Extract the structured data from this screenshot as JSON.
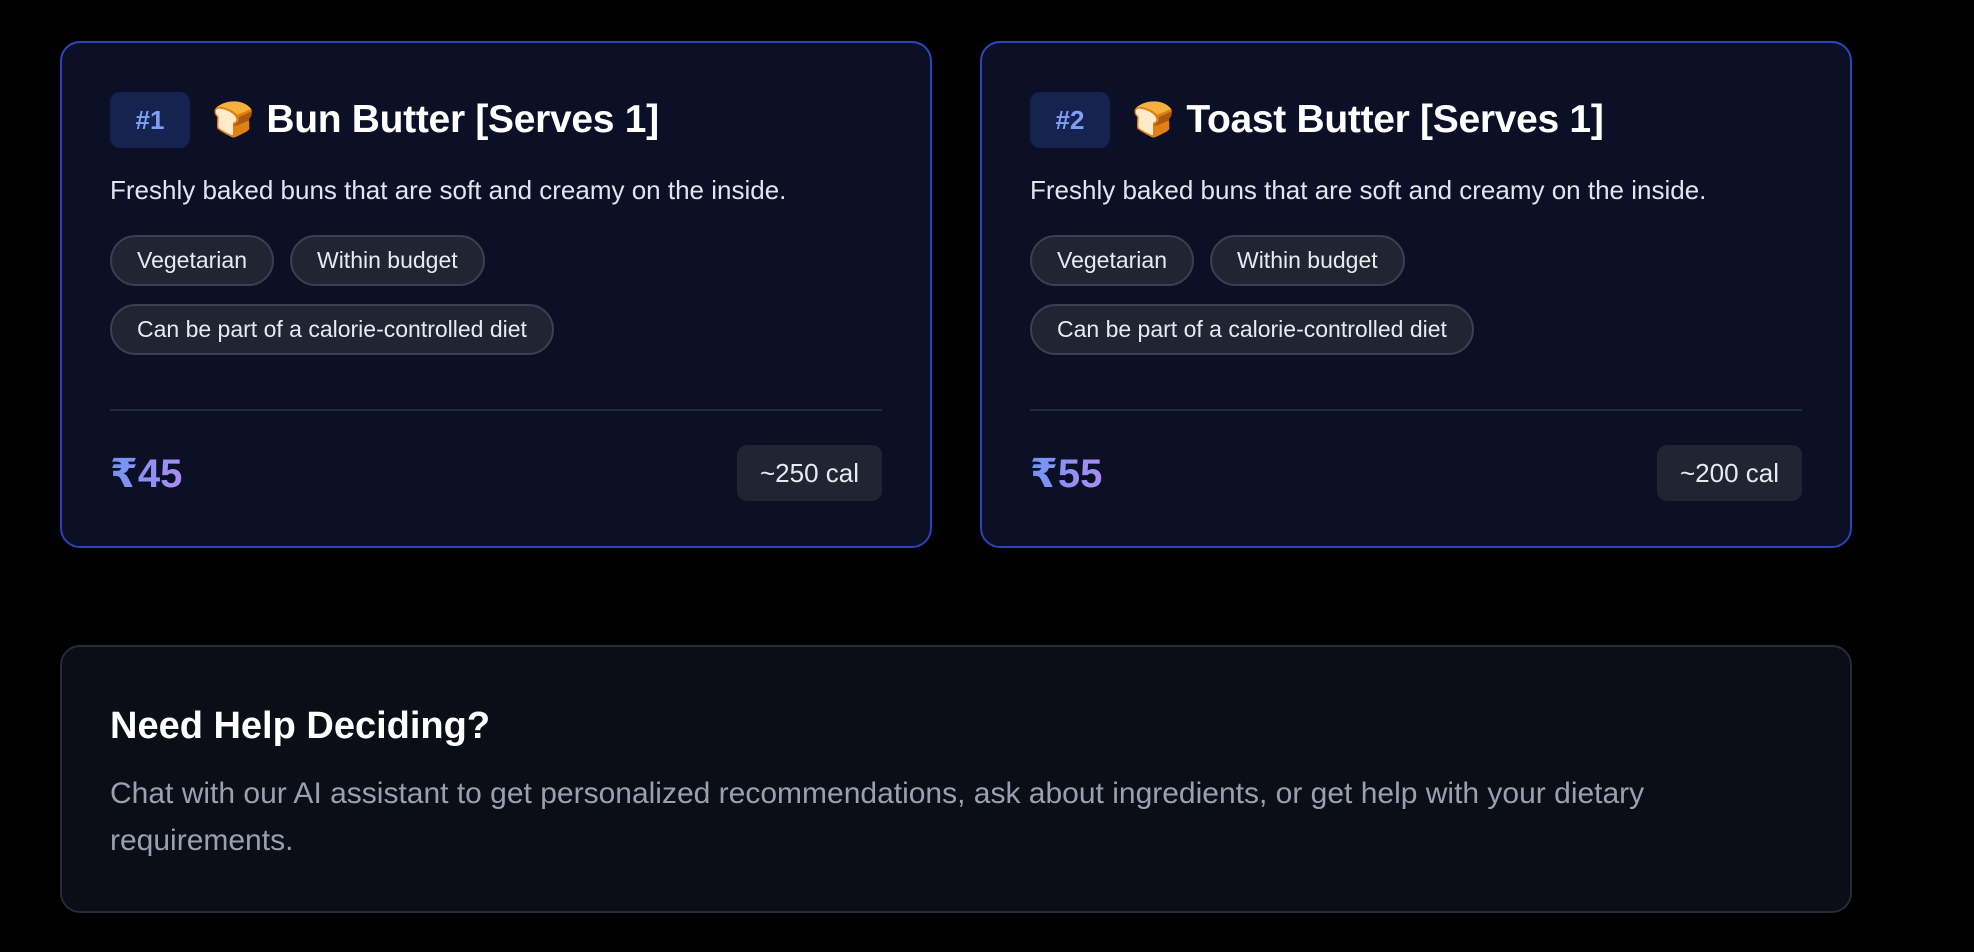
{
  "items": [
    {
      "rank": "#1",
      "emoji": "🍞",
      "name": "Bun Butter [Serves 1]",
      "description": "Freshly baked buns that are soft and creamy on the inside.",
      "tags": [
        "Vegetarian",
        "Within budget",
        "Can be part of a calorie-controlled diet"
      ],
      "price": "₹45",
      "calories": "~250 cal"
    },
    {
      "rank": "#2",
      "emoji": "🍞",
      "name": "Toast Butter [Serves 1]",
      "description": "Freshly baked buns that are soft and creamy on the inside.",
      "tags": [
        "Vegetarian",
        "Within budget",
        "Can be part of a calorie-controlled diet"
      ],
      "price": "₹55",
      "calories": "~200 cal"
    }
  ],
  "help": {
    "title": "Need Help Deciding?",
    "body": "Chat with our AI assistant to get personalized recommendations, ask about ingredients, or get help with your dietary requirements."
  },
  "colors": {
    "background": "#000000",
    "card_background": "#0b1027",
    "card_border": "#2e43b8",
    "rank_badge": "#162250",
    "price_gradient_start": "#6f95f4",
    "price_gradient_end": "#a98ef2"
  },
  "icons": {
    "item_icon": "bread-icon"
  }
}
